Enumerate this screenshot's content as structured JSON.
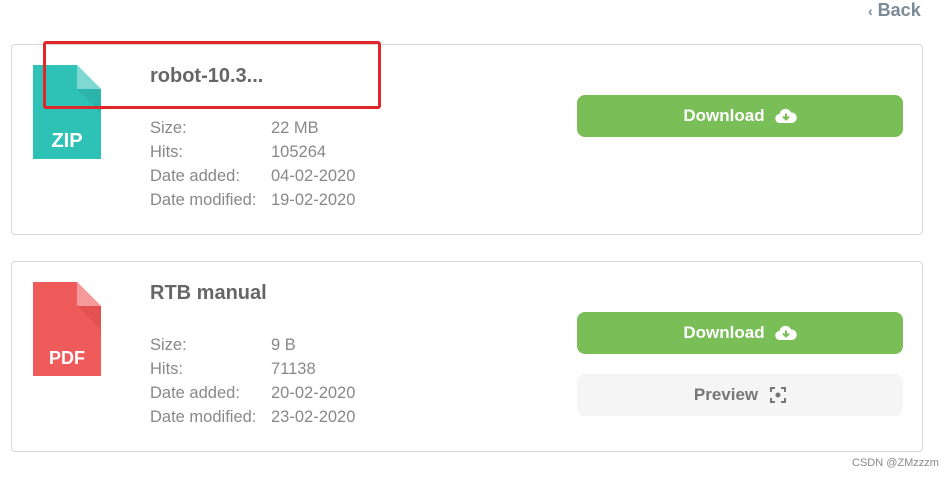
{
  "nav": {
    "back_label": "Back"
  },
  "files": [
    {
      "title": "robot-10.3...",
      "type_label": "ZIP",
      "icon_color": "#2ec1b5",
      "icon_fold_color": "#6fd6cd",
      "meta": [
        {
          "key": "Size:",
          "value": "22 MB"
        },
        {
          "key": "Hits:",
          "value": "105264"
        },
        {
          "key": "Date added:",
          "value": "04-02-2020"
        },
        {
          "key": "Date modified:",
          "value": "19-02-2020"
        }
      ],
      "download_label": "Download"
    },
    {
      "title": "RTB manual",
      "type_label": "PDF",
      "icon_color": "#ef5a5a",
      "icon_fold_color": "#f59191",
      "meta": [
        {
          "key": "Size:",
          "value": "9 B"
        },
        {
          "key": "Hits:",
          "value": "71138"
        },
        {
          "key": "Date added:",
          "value": "20-02-2020"
        },
        {
          "key": "Date modified:",
          "value": "23-02-2020"
        }
      ],
      "download_label": "Download",
      "preview_label": "Preview"
    }
  ],
  "colors": {
    "download_bg": "#79be57",
    "highlight": "#e0262a"
  },
  "icons": {
    "back": "chevron-left-icon",
    "download": "cloud-download-icon",
    "preview": "focus-frame-icon"
  },
  "watermark": "CSDN @ZMzzzm"
}
